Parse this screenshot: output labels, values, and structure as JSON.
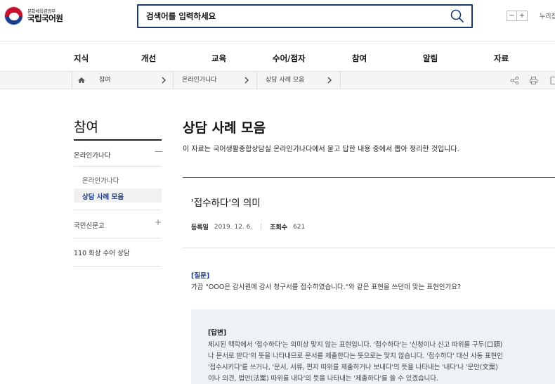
{
  "header": {
    "logo_sub": "문화체육관광부",
    "logo_main": "국립국어원",
    "search_placeholder": "검색어를 입력하세요",
    "zoom_out": "−",
    "zoom_in": "+",
    "nuri_label": "누리집"
  },
  "gnb": {
    "items": [
      "지식",
      "개선",
      "교육",
      "수어/점자",
      "참여",
      "알림",
      "자료"
    ]
  },
  "breadcrumb": {
    "items": [
      "참여",
      "온라인가나다",
      "상담 사례 모음"
    ]
  },
  "side": {
    "title": "참여",
    "items": [
      {
        "label": "온라인가나다",
        "toggle": "—"
      },
      {
        "label": "국민신문고",
        "toggle": "+"
      },
      {
        "label": "110 화상 수어 상담"
      }
    ],
    "sub_items": [
      "온라인가나다",
      "상담 사례 모음"
    ]
  },
  "content": {
    "title": "상담 사례 모음",
    "description": "이 자료는 국어생활종합상담실 온라인가나다에서 묻고 답한 내용 중에서 뽑아 정리한 것입니다.",
    "post_title": "'접수하다'의 의미",
    "meta": {
      "date_label": "등록일",
      "date_value": "2019. 12. 6.",
      "views_label": "조회수",
      "views_value": "621"
    },
    "question_label": "[질문]",
    "question_text": "가끔 \"OOO은 감사원에 감사 청구서를 접수하였습니다.\"와 같은 표현을 쓰던데 맞는 표현인가요?",
    "answer_label": "[답변]",
    "answer_lines": [
      "제시된 맥락에서 '접수하다'는 의미상 맞지 않는 표현입니다. '접수하다'는 '신청이나 신고 따위를 구두(口頭)",
      "나 문서로 받다'의 뜻을 나타내므로 문서를 제출한다는 뜻으로는 맞지 않습니다. '접수하다' 대신 사동 표현인",
      "'접수시키다'를 쓰거나, '문서, 서류, 편지 따위를 제출하거나 보내다'의 뜻을 나타내는 '내다'나 '문안(文案)",
      "이나 의견, 법안(法案) 따위를 내다'의 뜻을 나타내는 '제출하다'를 쓸 수 있겠습니다."
    ]
  },
  "icons": {
    "search": "search-icon",
    "home": "home-icon",
    "share": "share-icon",
    "print": "print-icon"
  },
  "colors": {
    "accent": "#1a3a8b",
    "search_border": "#1a3a6b",
    "answer_bg": "#eef1f5"
  }
}
